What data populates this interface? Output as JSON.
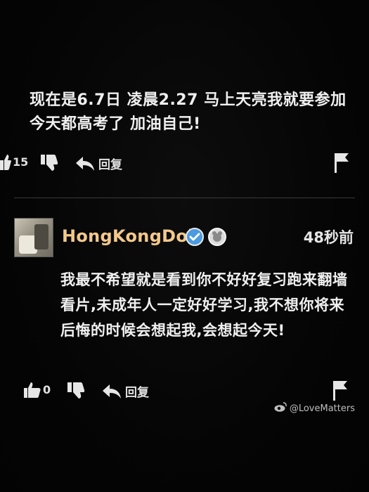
{
  "comment1": {
    "text": "现在是6.7日 凌晨2.27 马上天亮我就要参加今天都高考了 加油自己!",
    "likes": "15",
    "reply_label": "回复"
  },
  "comment2": {
    "username": "HongKongDoll",
    "timestamp": "48秒前",
    "text": "我最不希望就是看到你不好好复习跑来翻墙看片,未成年人一定好好学习,我不想你将来后悔的时候会想起我,会想起今天!",
    "likes": "0",
    "reply_label": "回复"
  },
  "watermark": {
    "text": "@LoveMatters"
  },
  "colors": {
    "background": "#050505",
    "text": "#f0f0f0",
    "username": "#f3c98a",
    "verified_badge": "#4a9be0"
  },
  "icons": [
    "thumbs-up-icon",
    "thumbs-down-icon",
    "reply-arrow-icon",
    "flag-icon",
    "verified-icon",
    "vip-badge-icon",
    "weibo-icon"
  ]
}
